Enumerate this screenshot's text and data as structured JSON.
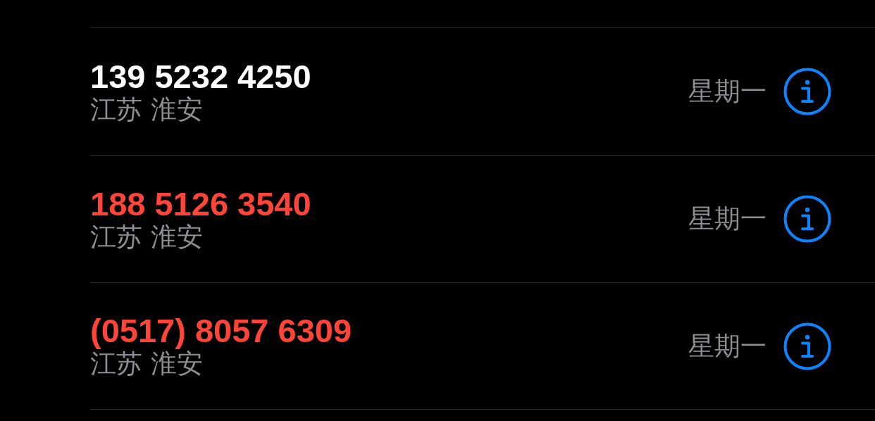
{
  "calls": [
    {
      "number": "139 5232 4250",
      "location": "江苏 淮安",
      "day": "星期一",
      "missed": false
    },
    {
      "number": "188 5126 3540",
      "location": "江苏 淮安",
      "day": "星期一",
      "missed": true
    },
    {
      "number": "(0517) 8057 6309",
      "location": "江苏 淮安",
      "day": "星期一",
      "missed": true
    }
  ]
}
